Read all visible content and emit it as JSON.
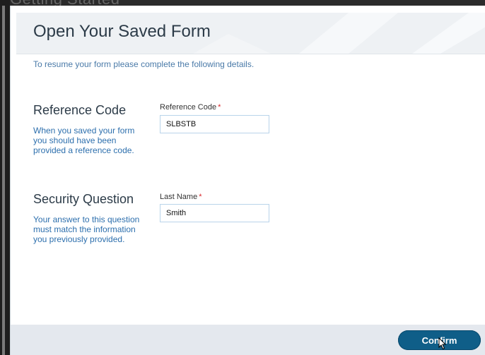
{
  "background": {
    "title": "Getting Started"
  },
  "modal": {
    "title": "Open Your Saved Form",
    "intro": "To resume your form please complete the following details.",
    "sections": [
      {
        "title": "Reference Code",
        "description": "When you saved your form you should have been provided a reference code.",
        "field_label": "Reference Code",
        "required_mark": "*",
        "value": "SLBSTB"
      },
      {
        "title": "Security Question",
        "description": "Your answer to this question must match the information you previously provided.",
        "field_label": "Last Name",
        "required_mark": "*",
        "value": "Smith"
      }
    ],
    "confirm_label": "Confirm"
  },
  "colors": {
    "accent": "#0f5e88",
    "link_text": "#2d6fad",
    "required": "#d9262a",
    "footer": "#e4e8ee"
  }
}
